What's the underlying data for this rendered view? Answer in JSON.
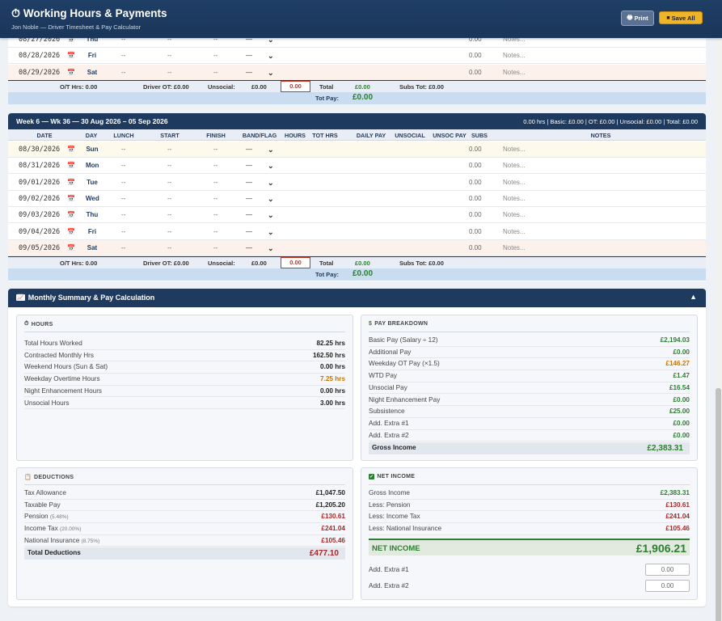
{
  "header": {
    "title": "Working Hours & Payments",
    "subtitle": "Jon Noble — Driver Timesheet & Pay Calculator",
    "print_label": "Print",
    "save_label": "Save All"
  },
  "week5": {
    "rows": [
      {
        "date": "08/27/2026",
        "day": "Thu",
        "lunch": "--",
        "start": "--",
        "finish": "--",
        "band": "—",
        "subs": "0.00",
        "notes": "Notes..."
      },
      {
        "date": "08/28/2026",
        "day": "Fri",
        "lunch": "--",
        "start": "--",
        "finish": "--",
        "band": "—",
        "subs": "0.00",
        "notes": "Notes..."
      },
      {
        "date": "08/29/2026",
        "day": "Sat",
        "lunch": "--",
        "start": "--",
        "finish": "--",
        "band": "—",
        "subs": "0.00",
        "notes": "Notes..."
      }
    ],
    "summary": {
      "ot_hrs": "O/T Hrs: 0.00",
      "driver_ot": "Driver OT: £0.00",
      "unsocial_label": "Unsocial:",
      "unsocial_value": "£0.00",
      "hours_value": "0.00",
      "total_label": "Total",
      "total_value": "£0.00",
      "subs_tot": "Subs Tot: £0.00"
    },
    "tot_pay_label": "Tot Pay:",
    "tot_pay_value": "£0.00"
  },
  "week6": {
    "title": "Week 6 — Wk 36 — 30 Aug 2026 – 05 Sep 2026",
    "stats": "0.00 hrs | Basic: £0.00 | OT: £0.00 | Unsocial: £0.00 | Total: £0.00",
    "columns": [
      "DATE",
      "DAY",
      "LUNCH",
      "START",
      "FINISH",
      "BAND/FLAG",
      "HOURS",
      "TOT HRS",
      "DAILY PAY",
      "UNSOCIAL",
      "UNSOC PAY",
      "SUBS",
      "NOTES"
    ],
    "rows": [
      {
        "date": "08/30/2026",
        "day": "Sun",
        "lunch": "--",
        "start": "--",
        "finish": "--",
        "band": "—",
        "subs": "0.00",
        "notes": "Notes..."
      },
      {
        "date": "08/31/2026",
        "day": "Mon",
        "lunch": "--",
        "start": "--",
        "finish": "--",
        "band": "—",
        "subs": "0.00",
        "notes": "Notes..."
      },
      {
        "date": "09/01/2026",
        "day": "Tue",
        "lunch": "--",
        "start": "--",
        "finish": "--",
        "band": "—",
        "subs": "0.00",
        "notes": "Notes..."
      },
      {
        "date": "09/02/2026",
        "day": "Wed",
        "lunch": "--",
        "start": "--",
        "finish": "--",
        "band": "—",
        "subs": "0.00",
        "notes": "Notes..."
      },
      {
        "date": "09/03/2026",
        "day": "Thu",
        "lunch": "--",
        "start": "--",
        "finish": "--",
        "band": "—",
        "subs": "0.00",
        "notes": "Notes..."
      },
      {
        "date": "09/04/2026",
        "day": "Fri",
        "lunch": "--",
        "start": "--",
        "finish": "--",
        "band": "—",
        "subs": "0.00",
        "notes": "Notes..."
      },
      {
        "date": "09/05/2026",
        "day": "Sat",
        "lunch": "--",
        "start": "--",
        "finish": "--",
        "band": "—",
        "subs": "0.00",
        "notes": "Notes..."
      }
    ],
    "summary": {
      "ot_hrs": "O/T Hrs: 0.00",
      "driver_ot": "Driver OT: £0.00",
      "unsocial_label": "Unsocial:",
      "unsocial_value": "£0.00",
      "hours_value": "0.00",
      "total_label": "Total",
      "total_value": "£0.00",
      "subs_tot": "Subs Tot: £0.00"
    },
    "tot_pay_label": "Tot Pay:",
    "tot_pay_value": "£0.00"
  },
  "summary": {
    "title": "Monthly Summary & Pay Calculation",
    "hours": {
      "title": "HOURS",
      "items": [
        {
          "label": "Total Hours Worked",
          "value": "82.25 hrs"
        },
        {
          "label": "Contracted Monthly Hrs",
          "value": "162.50 hrs"
        },
        {
          "label": "Weekend Hours (Sun & Sat)",
          "value": "0.00 hrs"
        },
        {
          "label": "Weekday Overtime Hours",
          "value": "7.25 hrs"
        },
        {
          "label": "Night Enhancement Hours",
          "value": "0.00 hrs"
        },
        {
          "label": "Unsocial Hours",
          "value": "3.00 hrs"
        }
      ]
    },
    "pay": {
      "title": "PAY BREAKDOWN",
      "items": [
        {
          "label": "Basic Pay (Salary ÷ 12)",
          "value": "£2,194.03"
        },
        {
          "label": "Additional Pay",
          "value": "£0.00"
        },
        {
          "label": "Weekday OT Pay (×1.5)",
          "value": "£146.27"
        },
        {
          "label": "WTD Pay",
          "value": "£1.47"
        },
        {
          "label": "Unsocial Pay",
          "value": "£16.54"
        },
        {
          "label": "Night Enhancement Pay",
          "value": "£0.00"
        },
        {
          "label": "Subsistence",
          "value": "£25.00"
        },
        {
          "label": "Add. Extra #1",
          "value": "£0.00"
        },
        {
          "label": "Add. Extra #2",
          "value": "£0.00"
        }
      ],
      "gross_label": "Gross Income",
      "gross_value": "£2,383.31"
    },
    "deductions": {
      "title": "DEDUCTIONS",
      "items": [
        {
          "label": "Tax Allowance",
          "note": "",
          "value": "£1,047.50"
        },
        {
          "label": "Taxable Pay",
          "note": "",
          "value": "£1,205.20"
        },
        {
          "label": "Pension",
          "note": "(5.48%)",
          "value": "£130.61"
        },
        {
          "label": "Income Tax",
          "note": "(20.00%)",
          "value": "£241.04"
        },
        {
          "label": "National Insurance",
          "note": "(8.75%)",
          "value": "£105.46"
        }
      ],
      "total_label": "Total Deductions",
      "total_value": "£477.10"
    },
    "net": {
      "title": "NET INCOME",
      "items": [
        {
          "label": "Gross Income",
          "value": "£2,383.31"
        },
        {
          "label": "Less: Pension",
          "value": "£130.61"
        },
        {
          "label": "Less: Income Tax",
          "value": "£241.04"
        },
        {
          "label": "Less: National Insurance",
          "value": "£105.46"
        }
      ],
      "net_label": "NET INCOME",
      "net_value": "£1,906.21",
      "extra1_label": "Add. Extra #1",
      "extra1_value": "0.00",
      "extra2_label": "Add. Extra #2",
      "extra2_value": "0.00"
    }
  }
}
